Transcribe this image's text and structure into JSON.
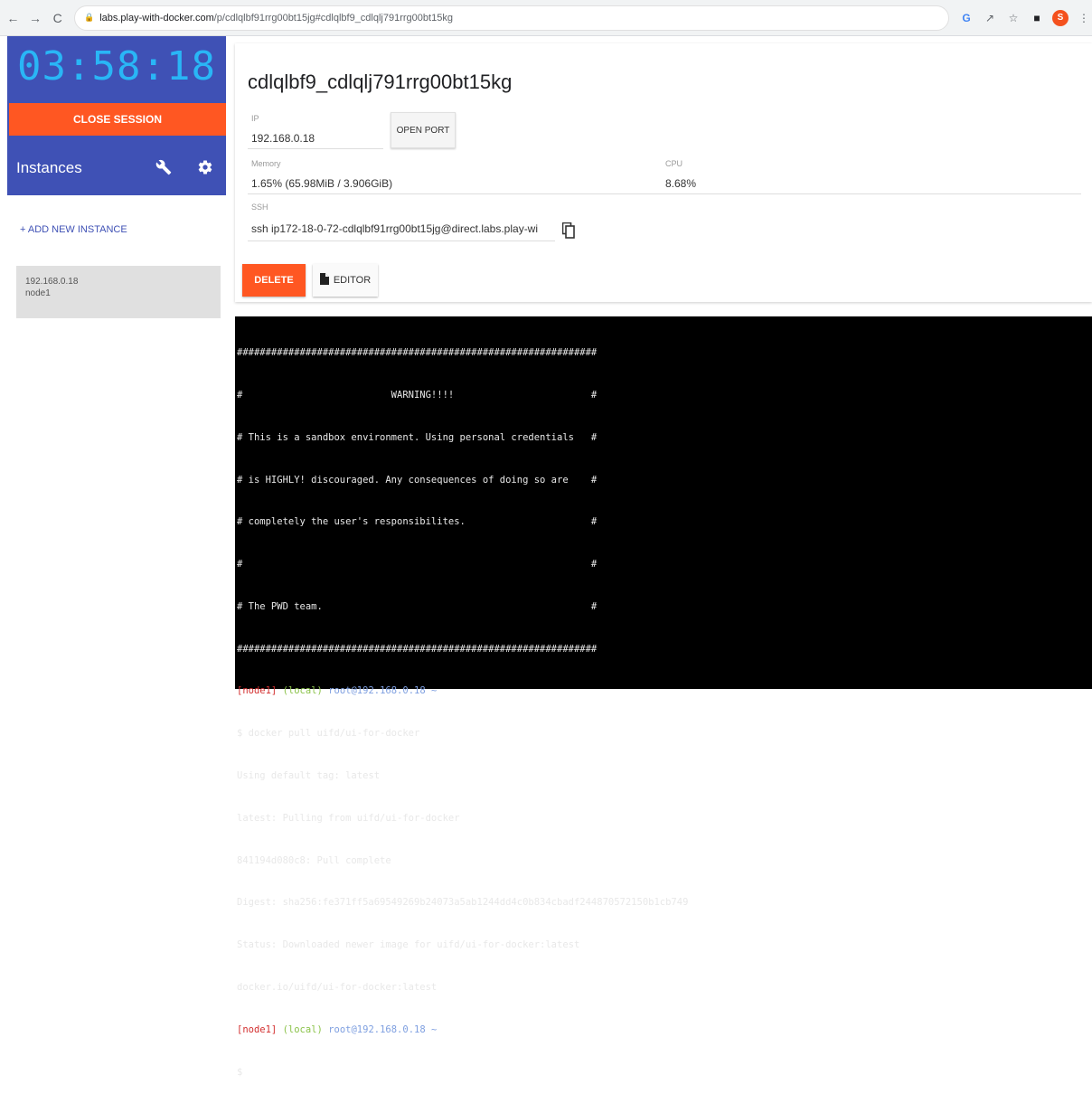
{
  "browser": {
    "back": "←",
    "forward": "→",
    "reload": "C",
    "url_host": "labs.play-with-docker.com",
    "url_path": "/p/cdlqlbf91rrg00bt15jg#cdlqlbf9_cdlqlj791rrg00bt15kg",
    "avatar": "S"
  },
  "sidebar": {
    "timer": "03:58:18",
    "close_session": "CLOSE SESSION",
    "instances_label": "Instances",
    "add_instance": "+ ADD NEW INSTANCE",
    "instance": {
      "ip": "192.168.0.18",
      "name": "node1"
    }
  },
  "instance": {
    "title": "cdlqlbf9_cdlqlj791rrg00bt15kg",
    "ip_label": "IP",
    "ip_value": "192.168.0.18",
    "open_port": "OPEN PORT",
    "memory_label": "Memory",
    "memory_value": "1.65% (65.98MiB / 3.906GiB)",
    "cpu_label": "CPU",
    "cpu_value": "8.68%",
    "ssh_label": "SSH",
    "ssh_value": "ssh ip172-18-0-72-cdlqlbf91rrg00bt15jg@direct.labs.play-wi",
    "delete": "DELETE",
    "editor": "EDITOR"
  },
  "terminal": {
    "banner": [
      "###############################################################",
      "#                          WARNING!!!!                        #",
      "# This is a sandbox environment. Using personal credentials   #",
      "# is HIGHLY! discouraged. Any consequences of doing so are    #",
      "# completely the user's responsibilites.                      #",
      "#                                                             #",
      "# The PWD team.                                               #",
      "###############################################################"
    ],
    "prompt_node": "[node1]",
    "prompt_local": "(local)",
    "prompt_user": "root@192.168.0.18 ~",
    "output": [
      "$ docker pull uifd/ui-for-docker",
      "Using default tag: latest",
      "latest: Pulling from uifd/ui-for-docker",
      "841194d080c8: Pull complete",
      "Digest: sha256:fe371ff5a69549269b24073a5ab1244dd4c0b834cbadf244870572150b1cb749",
      "Status: Downloaded newer image for uifd/ui-for-docker:latest",
      "docker.io/uifd/ui-for-docker:latest"
    ],
    "final_prompt": "$ "
  }
}
